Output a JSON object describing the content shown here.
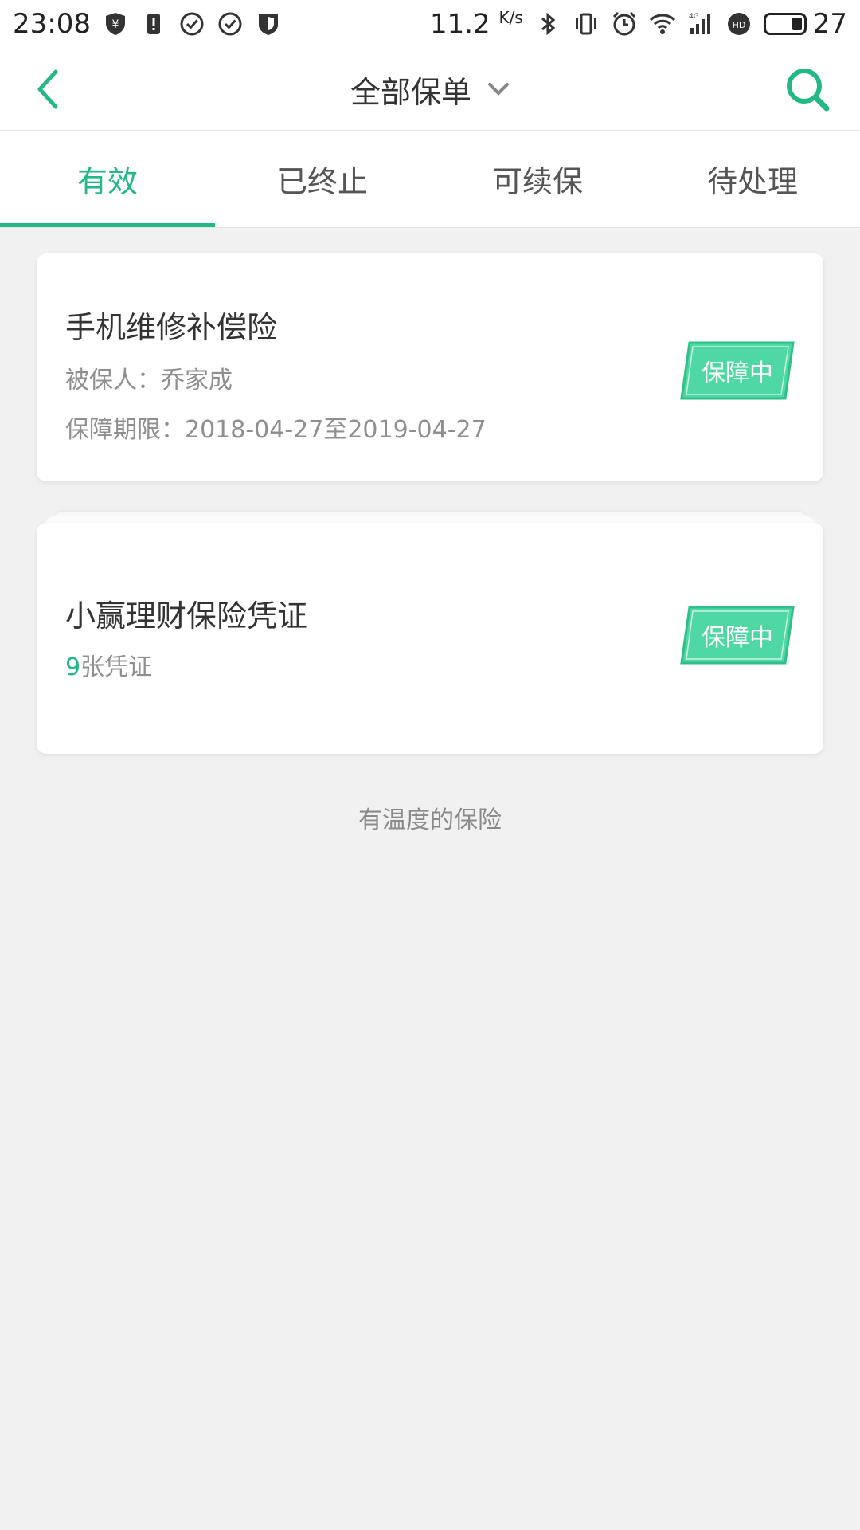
{
  "status_bar": {
    "time": "23:08",
    "net_speed": "11.2",
    "net_unit": "K/s",
    "battery_level": 27,
    "battery_text": "27",
    "icons": [
      "yen-shield-icon",
      "alert-icon",
      "check-circle-icon",
      "check-circle-icon",
      "shield-icon",
      "bluetooth-icon",
      "vibrate-icon",
      "alarm-icon",
      "wifi-icon",
      "signal-4g-icon",
      "hd-icon",
      "battery-icon"
    ]
  },
  "header": {
    "title": "全部保单",
    "accent_color": "#22b987"
  },
  "tabs": [
    {
      "label": "有效",
      "active": true
    },
    {
      "label": "已终止",
      "active": false
    },
    {
      "label": "可续保",
      "active": false
    },
    {
      "label": "待处理",
      "active": false
    }
  ],
  "policies": [
    {
      "title": "手机维修补偿险",
      "insured": "被保人：乔家成",
      "period": "保障期限：2018-04-27至2019-04-27",
      "status": "保障中"
    },
    {
      "title": "小赢理财保险凭证",
      "count": "9",
      "count_suffix": "张凭证",
      "status": "保障中"
    }
  ],
  "footer": "有温度的保险"
}
